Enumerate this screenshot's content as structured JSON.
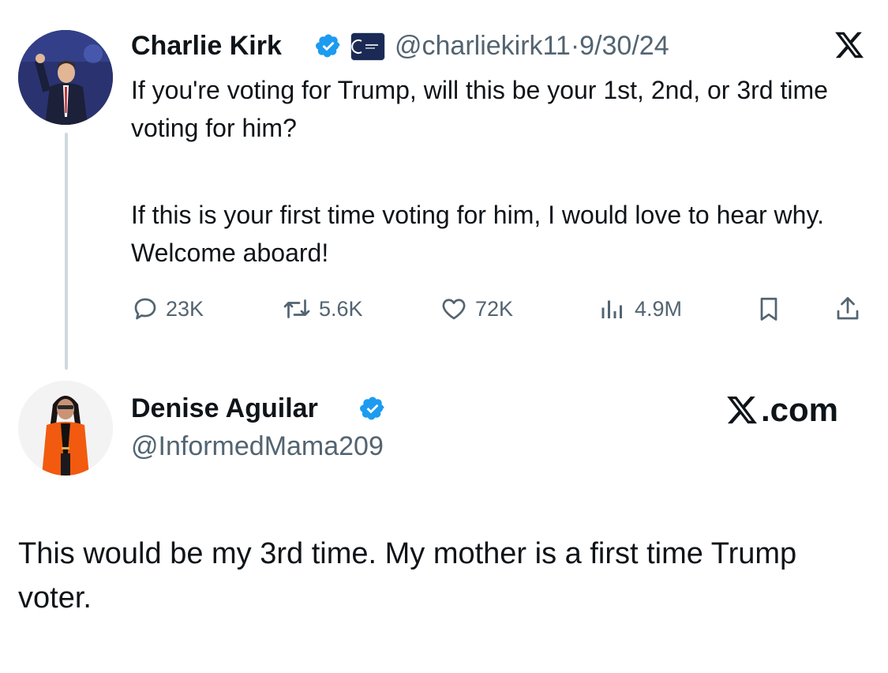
{
  "tweet": {
    "author_name": "Charlie Kirk",
    "author_handle": "@charliekirk11",
    "separator": "·",
    "date": "9/30/24",
    "paragraph_1": "If you're voting for Trump, will this be your 1st, 2nd, or 3rd time voting for him?",
    "paragraph_2": "If this is your first time voting for him, I would love to hear why. Welcome aboard!",
    "stats": {
      "replies": "23K",
      "reposts": "5.6K",
      "likes": "72K",
      "views": "4.9M"
    }
  },
  "reply": {
    "author_name": "Denise Aguilar",
    "author_handle": "@InformedMama209",
    "text": "This would be my 3rd time. My mother is a first time Trump voter."
  },
  "watermark": ".com",
  "colors": {
    "verified_blue": "#1d9bf0",
    "text": "#0f1419",
    "muted": "#536471",
    "thread_line": "#cfd9de"
  },
  "icons": [
    "verified-badge-icon",
    "affiliate-org-badge-icon",
    "x-logo-icon",
    "reply-icon",
    "repost-icon",
    "like-icon",
    "views-icon",
    "bookmark-icon",
    "share-icon"
  ]
}
